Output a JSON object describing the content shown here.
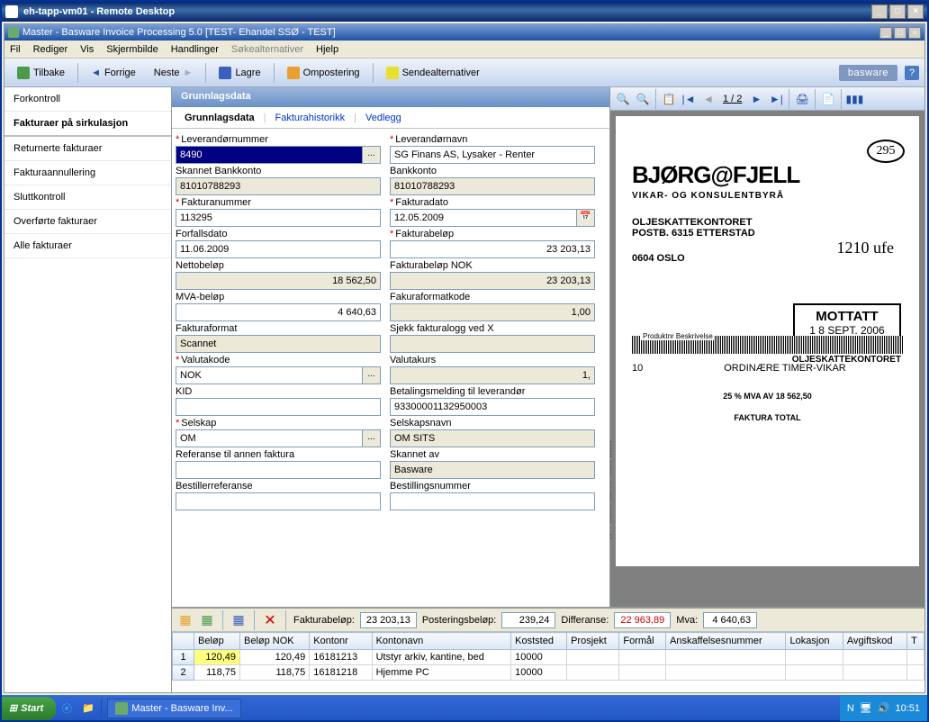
{
  "outer_title": "eh-tapp-vm01  -  Remote Desktop",
  "inner_title": "Master - Basware Invoice Processing 5.0 [TEST- Ehandel SSØ - TEST]",
  "menu": {
    "fil": "Fil",
    "rediger": "Rediger",
    "vis": "Vis",
    "skjermbilde": "Skjermbilde",
    "handlinger": "Handlinger",
    "sokealternativer": "Søkealternativer",
    "hjelp": "Hjelp"
  },
  "toolbar": {
    "tilbake": "Tilbake",
    "forrige": "Forrige",
    "neste": "Neste",
    "lagre": "Lagre",
    "ompostering": "Ompostering",
    "sendealternativer": "Sendealternativer",
    "brand": "basware"
  },
  "sidebar": {
    "items": [
      "Forkontroll",
      "Fakturaer på sirkulasjon",
      "Returnerte fakturaer",
      "Fakturaannullering",
      "Sluttkontroll",
      "Overførte fakturaer",
      "Alle fakturaer"
    ],
    "active": 1
  },
  "form": {
    "header": "Grunnlagsdata",
    "tabs": [
      "Grunnlagsdata",
      "Fakturahistorikk",
      "Vedlegg"
    ],
    "fields": {
      "leverandornummer": {
        "label": "Leverandørnummer",
        "value": "8490",
        "req": true,
        "lookup": true,
        "selected": true
      },
      "leverandornavn": {
        "label": "Leverandørnavn",
        "value": "SG Finans AS, Lysaker - Renter",
        "req": true
      },
      "skannet_bankkonto": {
        "label": "Skannet Bankkonto",
        "value": "81010788293",
        "ro": true
      },
      "bankkonto": {
        "label": "Bankkonto",
        "value": "81010788293",
        "ro": true
      },
      "fakturanummer": {
        "label": "Fakturanummer",
        "value": "113295",
        "req": true
      },
      "fakturadato": {
        "label": "Fakturadato",
        "value": "12.05.2009",
        "req": true,
        "date": true
      },
      "forfallsdato": {
        "label": "Forfallsdato",
        "value": "11.06.2009"
      },
      "fakturabelop": {
        "label": "Fakturabeløp",
        "value": "23 203,13",
        "req": true,
        "right": true
      },
      "nettobelop": {
        "label": "Nettobeløp",
        "value": "18 562,50",
        "ro": true,
        "right": true
      },
      "fakturabelop_nok": {
        "label": "Fakturabeløp NOK",
        "value": "23 203,13",
        "ro": true,
        "right": true
      },
      "mva_belop": {
        "label": "MVA-beløp",
        "value": "4 640,63",
        "right": true
      },
      "fakuraformatkode": {
        "label": "Fakuraformatkode",
        "value": "1,00",
        "ro": true,
        "right": true
      },
      "fakturaformat": {
        "label": "Fakturaformat",
        "value": "Scannet",
        "ro": true
      },
      "sjekk": {
        "label": "Sjekk fakturalogg ved X",
        "value": "",
        "ro": true
      },
      "valutakode": {
        "label": "Valutakode",
        "value": "NOK",
        "req": true,
        "lookup": true
      },
      "valutakurs": {
        "label": "Valutakurs",
        "value": "1,",
        "ro": true,
        "right": true
      },
      "kid": {
        "label": "KID",
        "value": ""
      },
      "betalingsmelding": {
        "label": "Betalingsmelding til leverandør",
        "value": "93300001132950003"
      },
      "selskap": {
        "label": "Selskap",
        "value": "OM",
        "req": true,
        "lookup": true
      },
      "selskapsnavn": {
        "label": "Selskapsnavn",
        "value": "OM SITS",
        "ro": true
      },
      "referanse": {
        "label": "Referanse til annen faktura",
        "value": ""
      },
      "skannet_av": {
        "label": "Skannet av",
        "value": "Basware",
        "ro": true
      },
      "bestillerreferanse": {
        "label": "Bestillerreferanse",
        "value": ""
      },
      "bestillingsnummer": {
        "label": "Bestillingsnummer",
        "value": ""
      }
    }
  },
  "preview": {
    "page": "1 / 2",
    "doc": {
      "stamp295": "295",
      "logo": "BJØRG@FJELL",
      "logo_sub": "VIKAR- OG KONSULENTBYRÅ",
      "addr1": "OLJESKATTEKONTORET",
      "addr2": "POSTB. 6315 ETTERSTAD",
      "handwritten": "1210 ufe",
      "city": "0604 OSLO",
      "mottatt": "MOTTATT",
      "mottatt_date": "1 8 SEPT. 2006",
      "osk": "OLJESKATTEKONTORET",
      "line10_num": "10",
      "line10_txt": "ORDINÆRE TIMER-VIKAR",
      "mva": "25 % MVA AV 18 562,50",
      "ftot": "FAKTURA TOTAL"
    }
  },
  "summary": {
    "fakturabelop_lbl": "Fakturabeløp:",
    "fakturabelop": "23 203,13",
    "posteringsbelop_lbl": "Posteringsbeløp:",
    "posteringsbelop": "239,24",
    "differanse_lbl": "Differanse:",
    "differanse": "22 963,89",
    "mva_lbl": "Mva:",
    "mva": "4 640,63"
  },
  "grid": {
    "cols": [
      "Beløp",
      "Beløp NOK",
      "Kontonr",
      "Kontonavn",
      "Koststed",
      "Prosjekt",
      "Formål",
      "Anskaffelsesnummer",
      "Lokasjon",
      "Avgiftskod",
      "T"
    ],
    "rows": [
      {
        "n": "1",
        "belop": "120,49",
        "belop_nok": "120,49",
        "kontonr": "16181213",
        "kontonavn": "Utstyr arkiv, kantine, bed",
        "koststed": "10000"
      },
      {
        "n": "2",
        "belop": "118,75",
        "belop_nok": "118,75",
        "kontonr": "16181218",
        "kontonavn": "Hjemme PC",
        "koststed": "10000"
      }
    ]
  },
  "taskbar": {
    "start": "Start",
    "task": "Master - Basware Inv...",
    "clock": "10:51"
  }
}
